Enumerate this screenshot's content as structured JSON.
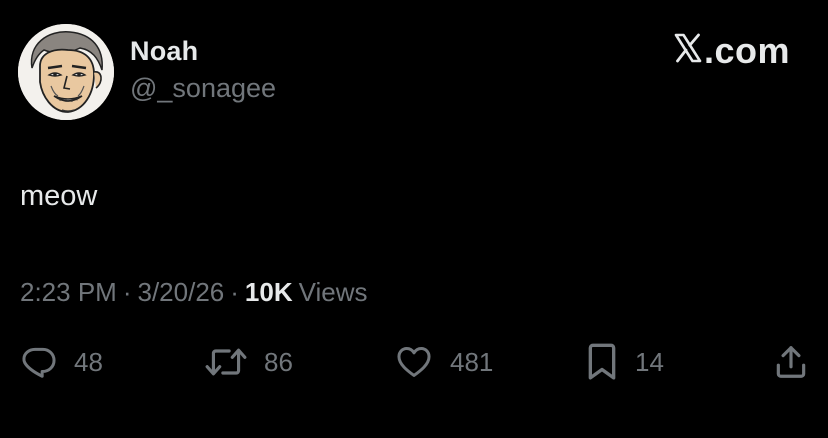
{
  "user": {
    "display_name": "Noah",
    "handle": "@_sonagee"
  },
  "brand": {
    "logo": "X",
    "suffix": ".com"
  },
  "tweet": {
    "text": "meow"
  },
  "meta": {
    "time": "2:23 PM",
    "separator": "·",
    "date": "3/20/26",
    "views_count": "10K",
    "views_label": "Views"
  },
  "actions": {
    "reply": {
      "icon": "reply-icon",
      "count": "48"
    },
    "retweet": {
      "icon": "retweet-icon",
      "count": "86"
    },
    "like": {
      "icon": "heart-icon",
      "count": "481"
    },
    "bookmark": {
      "icon": "bookmark-icon",
      "count": "14"
    },
    "share": {
      "icon": "share-icon"
    }
  },
  "colors": {
    "background": "#000000",
    "text_primary": "#e7e9ea",
    "text_secondary": "#71767b"
  }
}
